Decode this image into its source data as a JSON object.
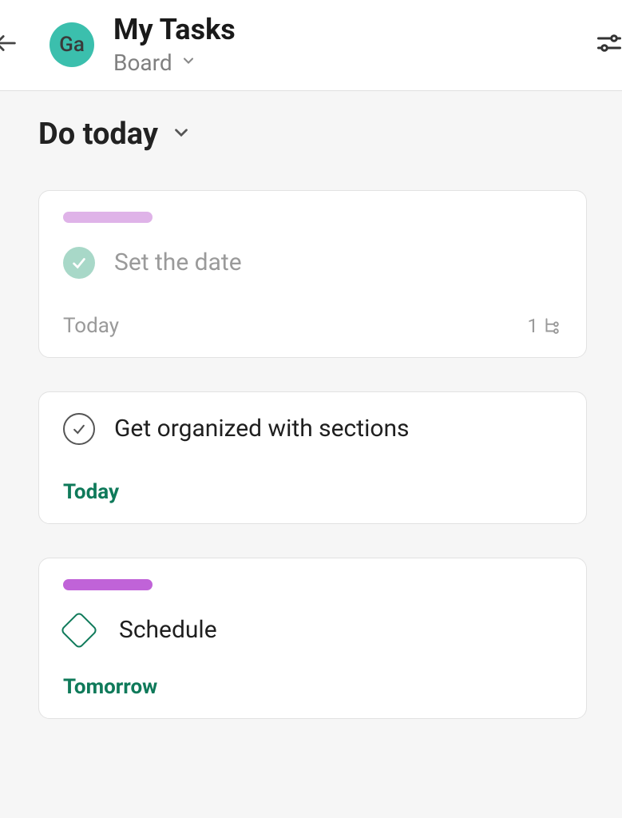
{
  "header": {
    "avatar_initials": "Ga",
    "title": "My Tasks",
    "view_label": "Board"
  },
  "section": {
    "title": "Do today"
  },
  "cards": [
    {
      "tag_variant": "light",
      "check_variant": "complete",
      "title": "Set the date",
      "title_muted": true,
      "due": "Today",
      "due_variant": "muted",
      "subtask_count": "1"
    },
    {
      "tag_variant": "none",
      "check_variant": "incomplete",
      "title": "Get organized with sections",
      "title_muted": false,
      "due": "Today",
      "due_variant": "green",
      "subtask_count": ""
    },
    {
      "tag_variant": "dark",
      "check_variant": "diamond",
      "title": "Schedule",
      "title_muted": false,
      "due": "Tomorrow",
      "due_variant": "green",
      "subtask_count": ""
    }
  ]
}
